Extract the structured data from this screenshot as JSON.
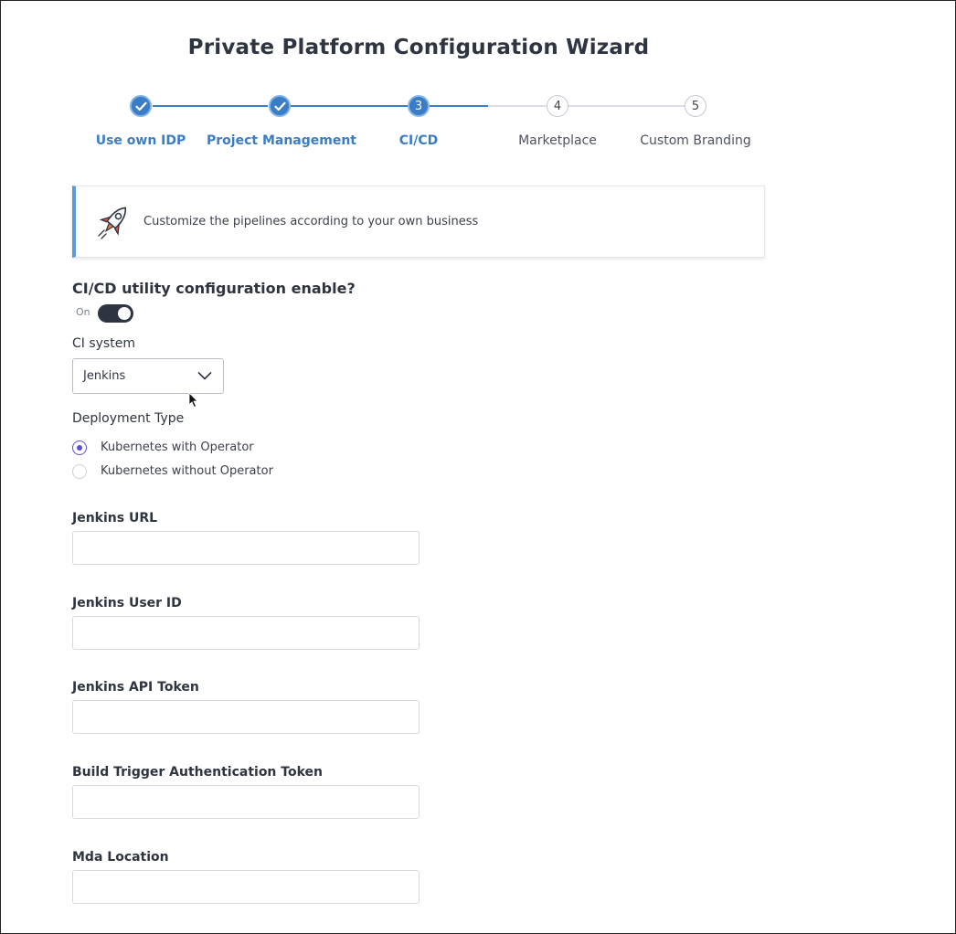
{
  "title": "Private Platform Configuration Wizard",
  "steps": [
    {
      "number": "1",
      "label": "Use own IDP",
      "state": "done"
    },
    {
      "number": "2",
      "label": "Project Management",
      "state": "done"
    },
    {
      "number": "3",
      "label": "CI/CD",
      "state": "active"
    },
    {
      "number": "4",
      "label": "Marketplace",
      "state": "todo"
    },
    {
      "number": "5",
      "label": "Custom Branding",
      "state": "todo"
    }
  ],
  "banner": {
    "text": "Customize the pipelines according to your own business",
    "icon": "rocket-icon"
  },
  "cicd": {
    "question": "CI/CD utility configuration enable?",
    "toggle_state": "On",
    "toggle_on": true
  },
  "ci_system": {
    "label": "CI system",
    "value": "Jenkins"
  },
  "deployment": {
    "label": "Deployment Type",
    "options": [
      "Kubernetes with Operator",
      "Kubernetes without Operator"
    ],
    "selected": "Kubernetes with Operator"
  },
  "fields": {
    "jenkins_url": {
      "label": "Jenkins URL",
      "value": ""
    },
    "jenkins_user_id": {
      "label": "Jenkins User ID",
      "value": ""
    },
    "jenkins_api_token": {
      "label": "Jenkins API Token",
      "value": ""
    },
    "build_trigger_token": {
      "label": "Build Trigger Authentication Token",
      "value": ""
    },
    "mda_location": {
      "label": "Mda Location",
      "value": ""
    }
  },
  "colors": {
    "accent": "#3b7dc4",
    "radio": "#5b4fd6",
    "toggle": "#2f3540"
  }
}
